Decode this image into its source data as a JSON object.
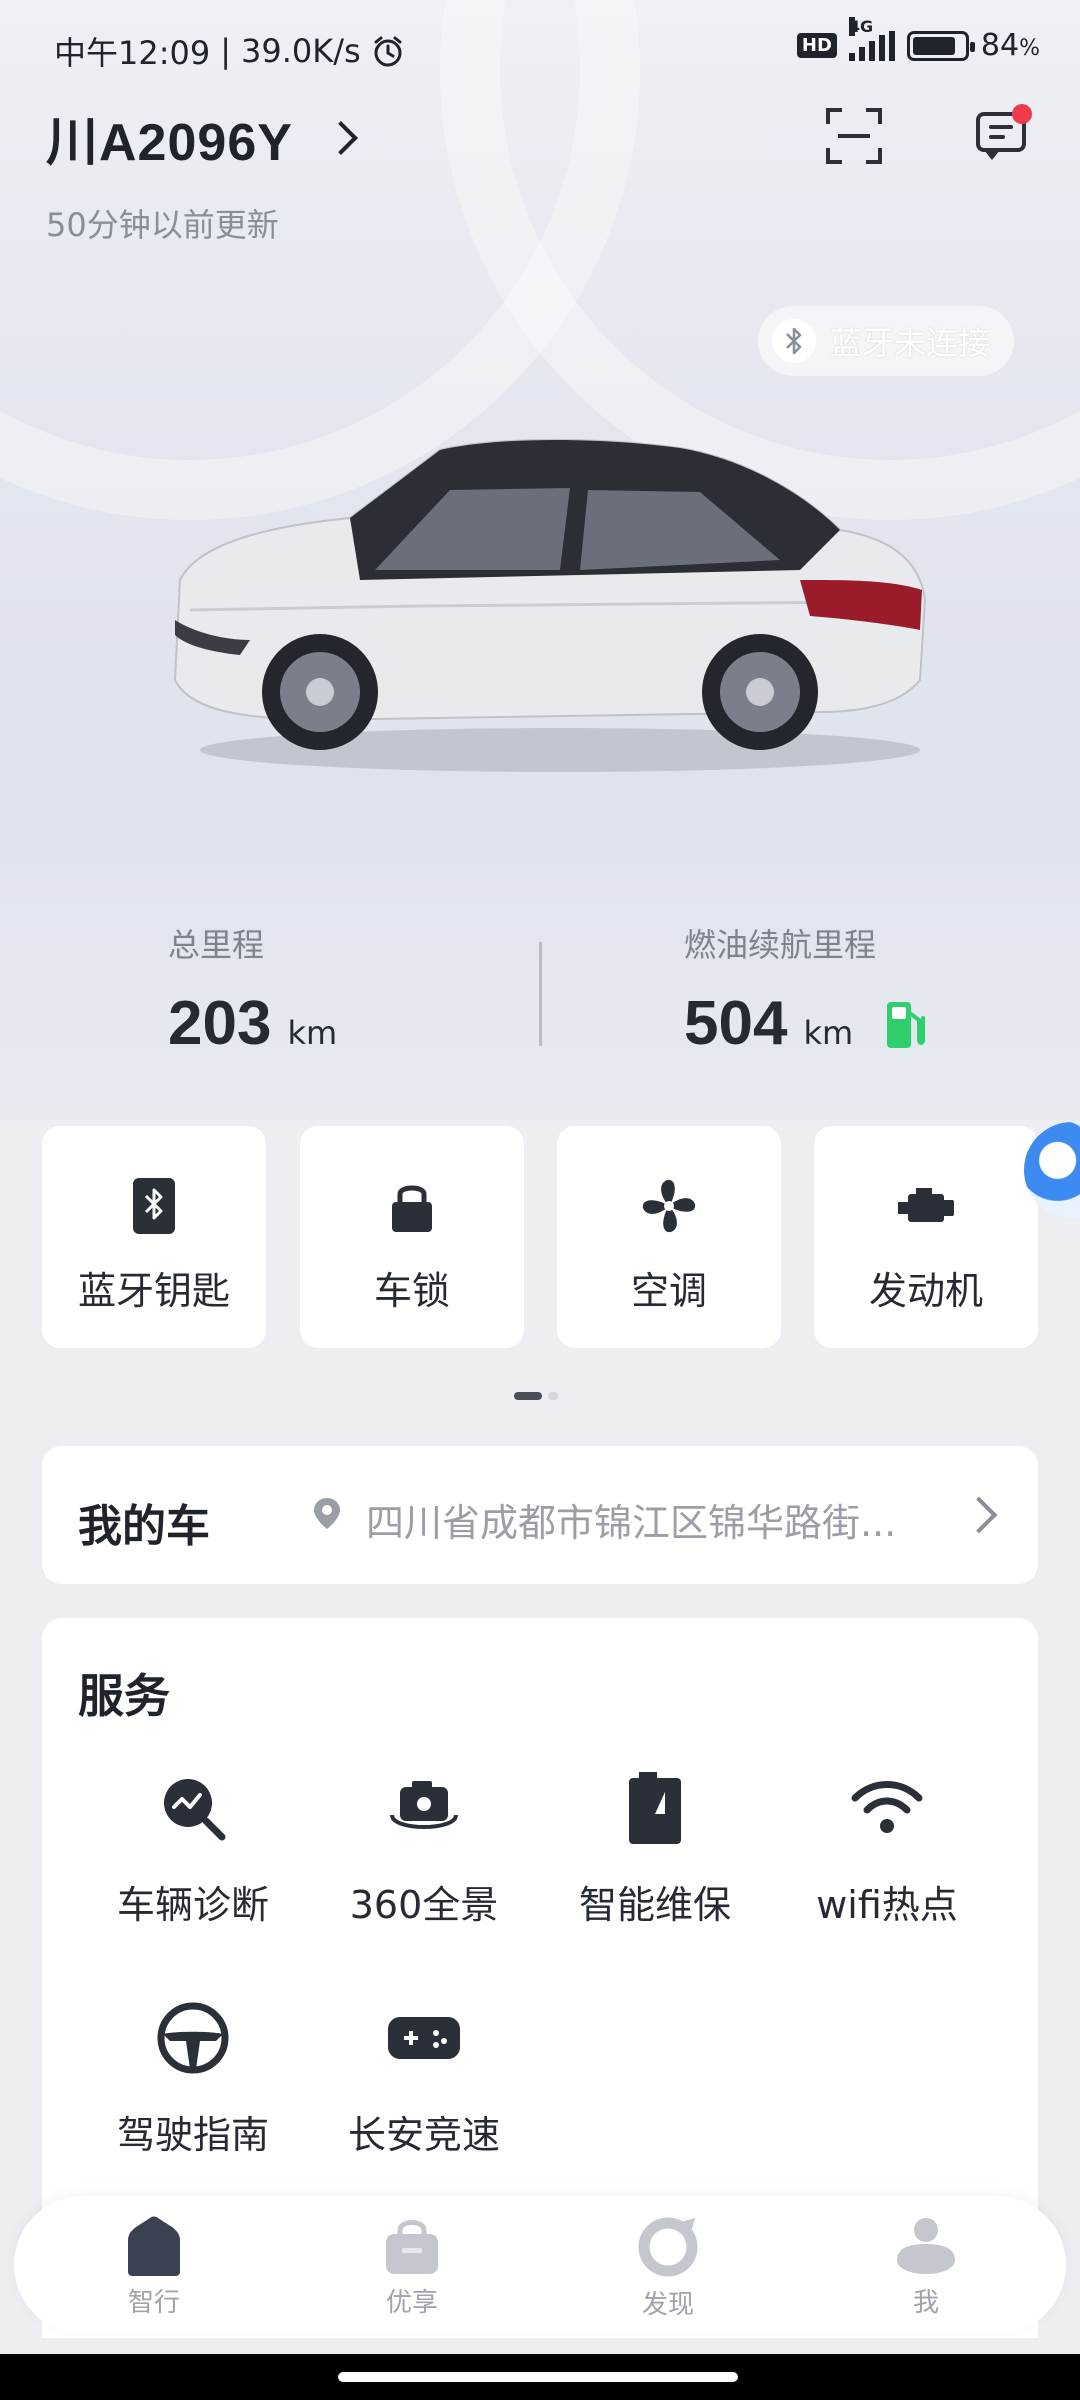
{
  "status_bar": {
    "time": "中午12:09",
    "net_speed": "39.0K/s",
    "hd": "HD",
    "network": "4G",
    "battery": "84",
    "battery_unit": "%",
    "battery_level": 0.84
  },
  "header": {
    "plate": "川A2096Y",
    "updated": "50分钟以前更新"
  },
  "bluetooth_status": "蓝牙未连接",
  "stats": {
    "total_label": "总里程",
    "total_value": "203",
    "total_unit": "km",
    "range_label": "燃油续航里程",
    "range_value": "504",
    "range_unit": "km"
  },
  "controls": [
    {
      "label": "蓝牙钥匙",
      "icon": "bluetooth-key-icon"
    },
    {
      "label": "车锁",
      "icon": "lock-icon"
    },
    {
      "label": "空调",
      "icon": "fan-icon"
    },
    {
      "label": "发动机",
      "icon": "engine-icon"
    }
  ],
  "pager": {
    "pages": 2,
    "current": 1
  },
  "my_car": {
    "title": "我的车",
    "address": "四川省成都市锦江区锦华路街..."
  },
  "service": {
    "title": "服务",
    "items": [
      {
        "label": "车辆诊断",
        "icon": "diagnosis-icon"
      },
      {
        "label": "360全景",
        "icon": "camera-360-icon"
      },
      {
        "label": "智能维保",
        "icon": "maintenance-icon"
      },
      {
        "label": "wifi热点",
        "icon": "wifi-icon"
      },
      {
        "label": "驾驶指南",
        "icon": "steering-wheel-icon"
      },
      {
        "label": "长安竞速",
        "icon": "gamepad-icon"
      }
    ]
  },
  "nav": [
    {
      "label": "智行",
      "icon": "home-icon"
    },
    {
      "label": "优享",
      "icon": "bag-icon"
    },
    {
      "label": "发现",
      "icon": "discover-icon"
    },
    {
      "label": "我",
      "icon": "profile-icon"
    }
  ],
  "colors": {
    "accent_dark": "#2a2f38",
    "fuel_green": "#2fcf6e",
    "badge_red": "#f0394b"
  }
}
